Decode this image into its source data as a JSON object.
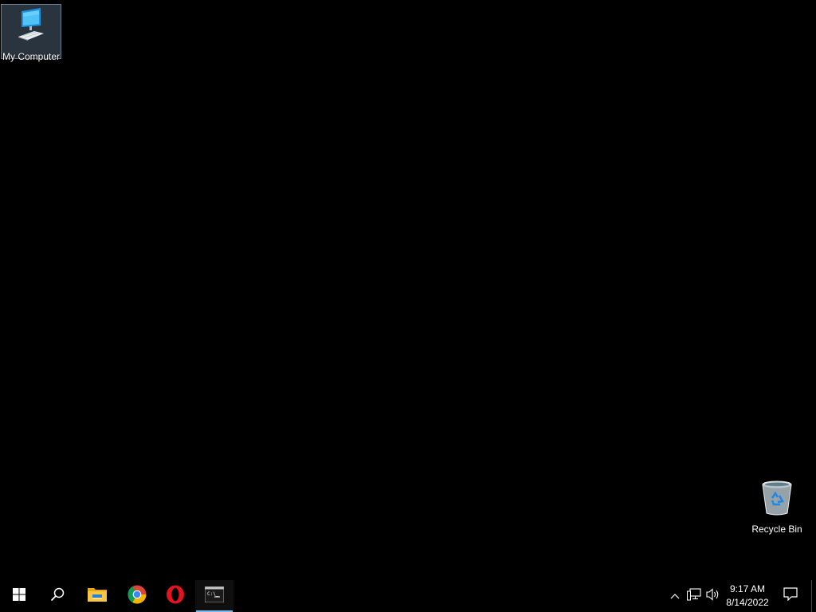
{
  "desktop": {
    "icons": [
      {
        "label": "My Computer",
        "icon": "computer-icon",
        "selected": true
      },
      {
        "label": "Recycle Bin",
        "icon": "recycle-bin-icon",
        "selected": false
      }
    ],
    "background_color": "#000000"
  },
  "taskbar": {
    "start_icon": "windows-logo-icon",
    "search_icon": "search-icon",
    "pinned": [
      {
        "name": "File Explorer",
        "icon": "folder-icon"
      },
      {
        "name": "Google Chrome",
        "icon": "chrome-icon"
      },
      {
        "name": "Opera",
        "icon": "opera-icon"
      },
      {
        "name": "Command Prompt",
        "icon": "cmd-icon",
        "active": true
      }
    ],
    "tray": {
      "icons": [
        "chevron-up-icon",
        "network-icon",
        "volume-icon"
      ],
      "time": "9:17 AM",
      "date": "8/14/2022",
      "notification_icon": "notification-icon"
    },
    "accent_color": "#76b9ed"
  }
}
